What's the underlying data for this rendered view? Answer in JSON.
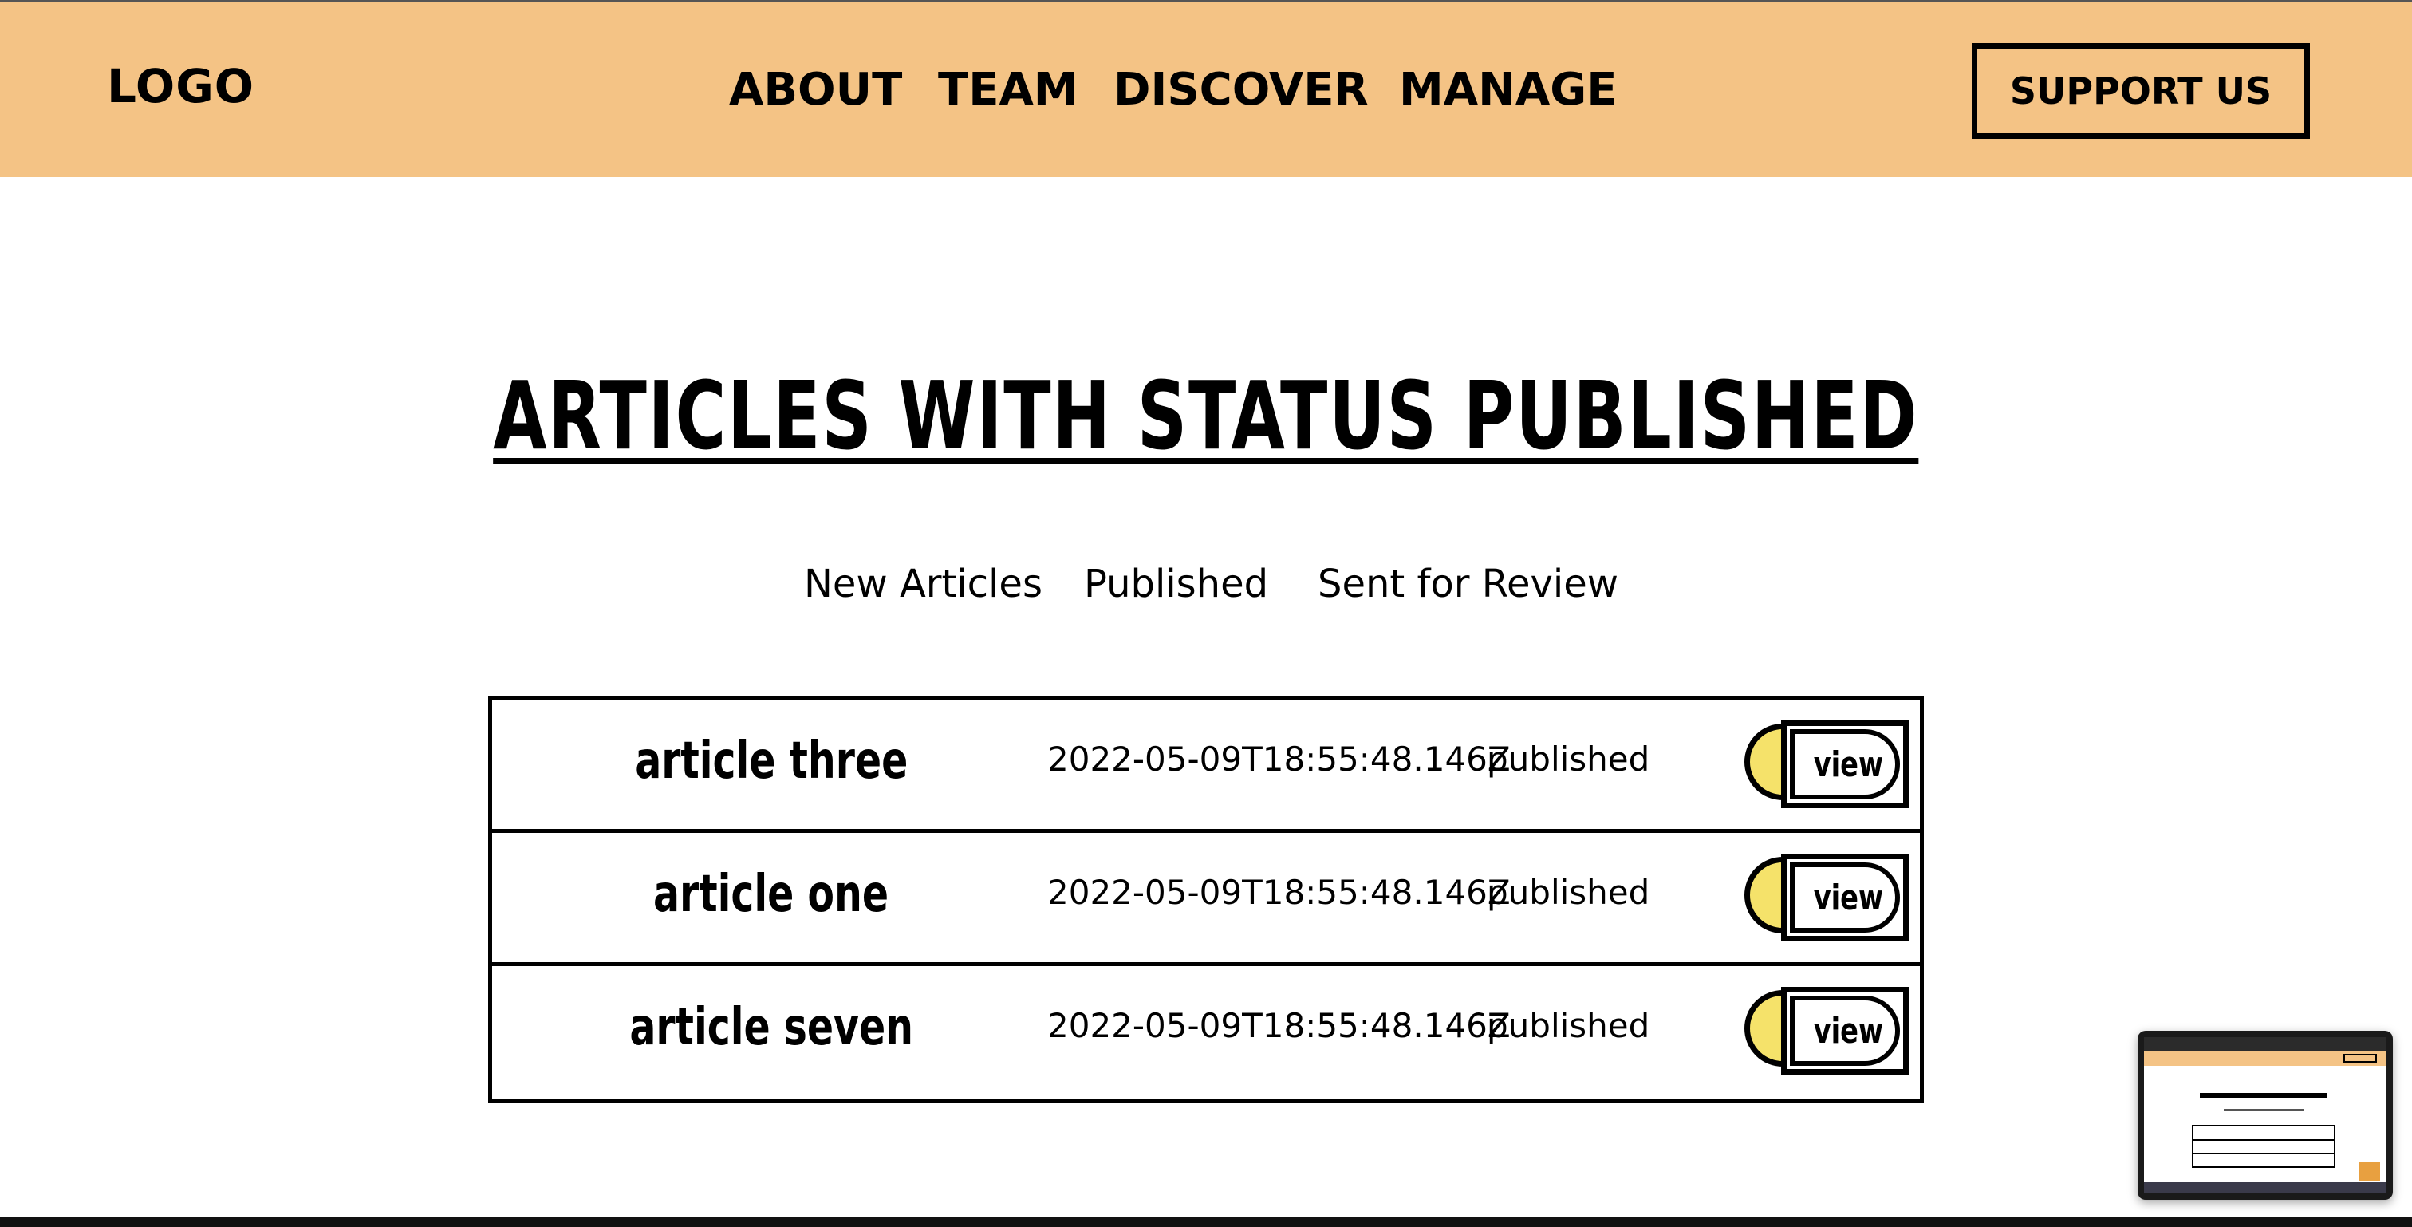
{
  "header": {
    "logo": "LOGO",
    "nav": [
      "ABOUT",
      "TEAM",
      "DISCOVER",
      "MANAGE"
    ],
    "support_label": "SUPPORT US"
  },
  "page_title": "ARTICLES WITH STATUS PUBLISHED",
  "tabs": [
    "New Articles",
    "Published",
    "Sent for Review"
  ],
  "articles": [
    {
      "title": "article three",
      "date": "2022-05-09T18:55:48.146Z",
      "status": "published",
      "action": "view"
    },
    {
      "title": "article one",
      "date": "2022-05-09T18:55:48.146Z",
      "status": "published",
      "action": "view"
    },
    {
      "title": "article seven",
      "date": "2022-05-09T18:55:48.146Z",
      "status": "published",
      "action": "view"
    }
  ],
  "colors": {
    "header_bg": "#f4c385",
    "view_pill": "#f5e26a",
    "text": "#000000"
  }
}
